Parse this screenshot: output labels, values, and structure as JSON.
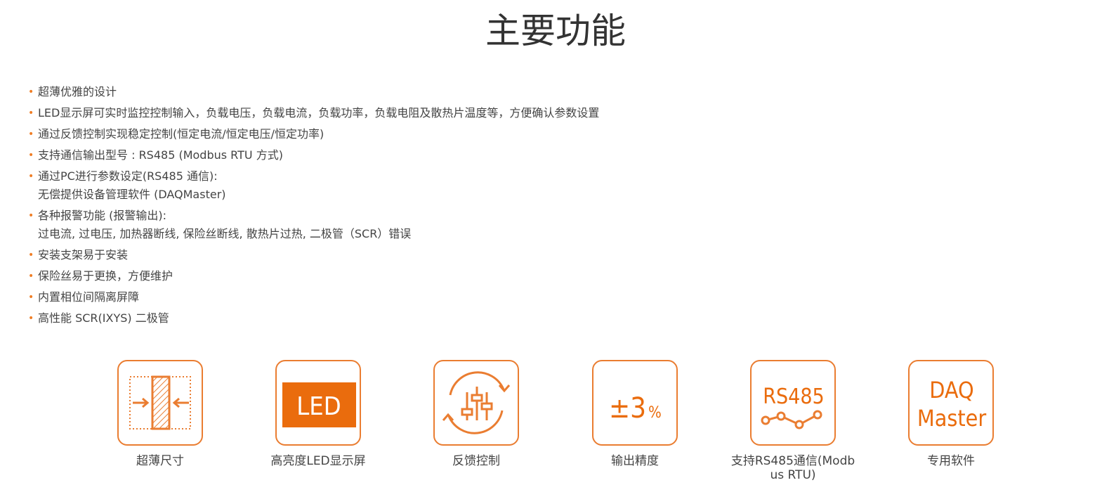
{
  "title": "主要功能",
  "colors": {
    "accent": "#ea7d31",
    "led_fill": "#ea6c0d",
    "text": "#444444",
    "title": "#333333"
  },
  "features": [
    {
      "lines": [
        "超薄优雅的设计"
      ]
    },
    {
      "lines": [
        "LED显示屏可实时监控控制输入，负载电压，负载电流，负载功率，负载电阻及散热片温度等，方便确认参数设置"
      ]
    },
    {
      "lines": [
        "通过反馈控制实现稳定控制(恒定电流/恒定电压/恒定功率)"
      ]
    },
    {
      "lines": [
        "支持通信输出型号 : RS485 (Modbus RTU 方式)"
      ]
    },
    {
      "lines": [
        "通过PC进行参数设定(RS485 通信):",
        "无偿提供设备管理软件 (DAQMaster)"
      ]
    },
    {
      "lines": [
        "各种报警功能 (报警输出):",
        "过电流, 过电压, 加热器断线, 保险丝断线, 散热片过热, 二极管（SCR）错误"
      ]
    },
    {
      "lines": [
        "安装支架易于安装"
      ]
    },
    {
      "lines": [
        "保险丝易于更换，方便维护"
      ]
    },
    {
      "lines": [
        "内置相位间隔离屏障"
      ]
    },
    {
      "lines": [
        "高性能 SCR(IXYS) 二极管"
      ]
    }
  ],
  "icons": [
    {
      "icon": "slim-size-icon",
      "caption": "超薄尺寸"
    },
    {
      "icon": "led-display-icon",
      "caption": "高亮度LED显示屏",
      "label": "LED"
    },
    {
      "icon": "feedback-control-icon",
      "caption": "反馈控制"
    },
    {
      "icon": "accuracy-icon",
      "caption": "输出精度",
      "label_main": "±3",
      "label_unit": "%"
    },
    {
      "icon": "rs485-icon",
      "caption": "支持RS485通信(Modbus RTU)",
      "label": "RS485"
    },
    {
      "icon": "daqmaster-icon",
      "caption": "专用软件",
      "label_line1": "DAQ",
      "label_line2": "Master"
    }
  ]
}
